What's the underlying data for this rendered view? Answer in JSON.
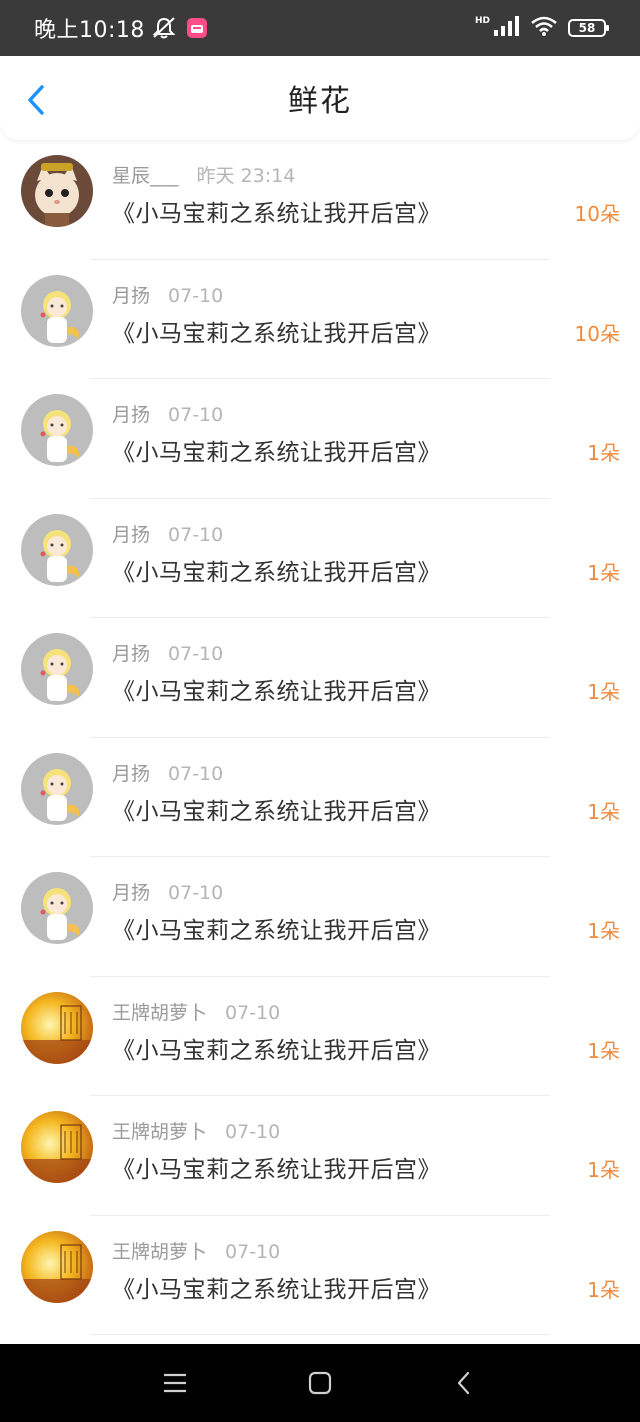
{
  "status_bar": {
    "time": "晚上10:18",
    "hd": "HD",
    "battery": "58"
  },
  "header": {
    "title": "鲜花"
  },
  "colors": {
    "accent": "#1e90ff",
    "count": "#f08a3c"
  },
  "rows": [
    {
      "name": "星辰___",
      "time": "昨天 23:14",
      "book": "《小马宝莉之系统让我开后宫》",
      "count": "10朵",
      "avatar": "cat-avatar"
    },
    {
      "name": "月扬",
      "time": "07-10",
      "book": "《小马宝莉之系统让我开后宫》",
      "count": "10朵",
      "avatar": "anime-girl-avatar"
    },
    {
      "name": "月扬",
      "time": "07-10",
      "book": "《小马宝莉之系统让我开后宫》",
      "count": "1朵",
      "avatar": "anime-girl-avatar"
    },
    {
      "name": "月扬",
      "time": "07-10",
      "book": "《小马宝莉之系统让我开后宫》",
      "count": "1朵",
      "avatar": "anime-girl-avatar"
    },
    {
      "name": "月扬",
      "time": "07-10",
      "book": "《小马宝莉之系统让我开后宫》",
      "count": "1朵",
      "avatar": "anime-girl-avatar"
    },
    {
      "name": "月扬",
      "time": "07-10",
      "book": "《小马宝莉之系统让我开后宫》",
      "count": "1朵",
      "avatar": "anime-girl-avatar"
    },
    {
      "name": "月扬",
      "time": "07-10",
      "book": "《小马宝莉之系统让我开后宫》",
      "count": "1朵",
      "avatar": "anime-girl-avatar"
    },
    {
      "name": "王牌胡萝卜",
      "time": "07-10",
      "book": "《小马宝莉之系统让我开后宫》",
      "count": "1朵",
      "avatar": "sunset-avatar"
    },
    {
      "name": "王牌胡萝卜",
      "time": "07-10",
      "book": "《小马宝莉之系统让我开后宫》",
      "count": "1朵",
      "avatar": "sunset-avatar"
    },
    {
      "name": "王牌胡萝卜",
      "time": "07-10",
      "book": "《小马宝莉之系统让我开后宫》",
      "count": "1朵",
      "avatar": "sunset-avatar"
    }
  ]
}
